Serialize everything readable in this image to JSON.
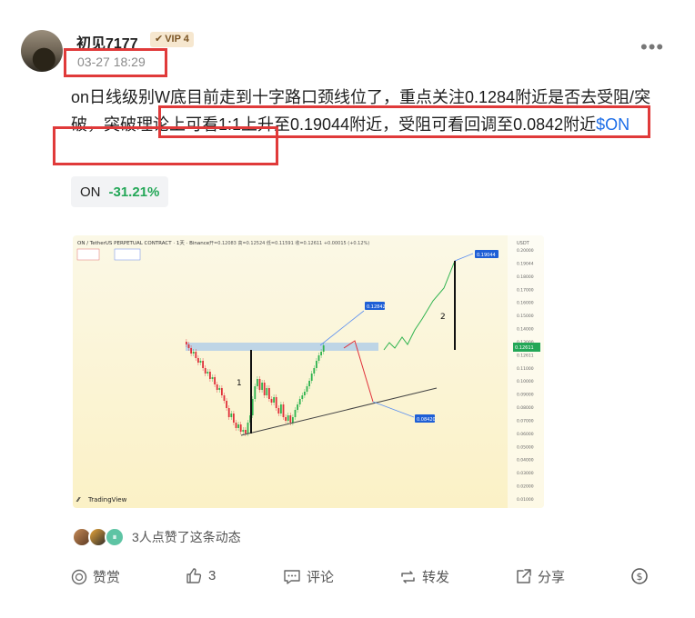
{
  "post": {
    "author": {
      "name": "初见7177",
      "vip_badge": "VIP 4",
      "vip_icon": "verified-check-icon",
      "avatar_icon": "user-avatar"
    },
    "timestamp": "03-27 18:29",
    "more_icon": "more-dots-icon",
    "text_main": "on日线级别W底目前走到十字路口颈线位了，重点关注0.1284附近是否去受阻/突破，突破理论上可看1:1上升至0.19044附近，受阻可看回调至0.0842附近",
    "cashtag": "$ON",
    "ticker": {
      "symbol": "ON",
      "change": "-31.21%",
      "change_color": "#23a757"
    },
    "chart": {
      "title": "ON / TetherUS PERPETUAL CONTRACT · 1天 · Binance",
      "ohlc": "开=0.12083 高=0.12524 低=0.11591 收=0.12611 +0.00015 (+0.12%)",
      "brand": "TradingView",
      "currency": "USDT",
      "labels": {
        "target_up_1": "0.12842",
        "target_down": "0.08420",
        "target_up_2": "0.19044",
        "current": "0.12611"
      },
      "annotations": {
        "leg1": "1",
        "leg2": "2"
      },
      "y_ticks": [
        "0.20000",
        "0.19044",
        "0.18000",
        "0.17000",
        "0.16000",
        "0.15000",
        "0.14000",
        "0.13000",
        "0.12611",
        "0.11000",
        "0.10000",
        "0.09000",
        "0.08000",
        "0.07000",
        "0.06000",
        "0.05000",
        "0.04000",
        "0.03000",
        "0.02000",
        "0.01000"
      ],
      "neckline": 0.1284,
      "colors": {
        "accent_blue": "#1e5fd6",
        "up_green": "#2fb34f",
        "down_red": "#e0303a"
      }
    },
    "likes": {
      "count_text": "3人点赞了这条动态"
    },
    "actions": {
      "tip_label": "赞赏",
      "like_count": "3",
      "comment_label": "评论",
      "repost_label": "转发",
      "share_label": "分享",
      "tip_icon": "coin-icon",
      "like_icon": "thumbs-up-icon",
      "comment_icon": "comment-icon",
      "repost_icon": "repost-icon",
      "share_icon": "share-icon",
      "currency_icon": "dollar-circle-icon"
    }
  }
}
